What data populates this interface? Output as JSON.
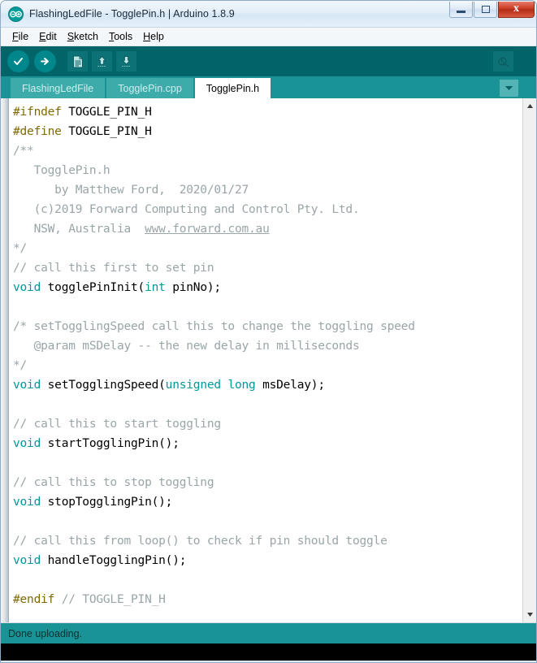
{
  "window": {
    "title": "FlashingLedFile - TogglePin.h | Arduino 1.8.9",
    "app_icon": "arduino-logo-icon",
    "controls": {
      "minimize_label": "Minimize",
      "maximize_label": "Maximize",
      "close_label": "x"
    }
  },
  "menu": {
    "items": [
      {
        "mnemonic": "F",
        "rest": "ile"
      },
      {
        "mnemonic": "E",
        "rest": "dit"
      },
      {
        "mnemonic": "S",
        "rest": "ketch"
      },
      {
        "mnemonic": "T",
        "rest": "ools"
      },
      {
        "mnemonic": "H",
        "rest": "elp"
      }
    ]
  },
  "toolbar": {
    "buttons": [
      {
        "name": "verify-button",
        "icon": "checkmark-icon",
        "tooltip": "Verify"
      },
      {
        "name": "upload-button",
        "icon": "right-arrow-icon",
        "tooltip": "Upload"
      },
      {
        "name": "new-button",
        "icon": "new-file-icon",
        "tooltip": "New"
      },
      {
        "name": "open-button",
        "icon": "up-arrow-icon",
        "tooltip": "Open"
      },
      {
        "name": "save-button",
        "icon": "down-arrow-icon",
        "tooltip": "Save"
      }
    ],
    "serial_monitor": {
      "icon": "serial-monitor-icon",
      "tooltip": "Serial Monitor"
    }
  },
  "tabs": {
    "items": [
      {
        "label": "FlashingLedFile",
        "active": false
      },
      {
        "label": "TogglePin.cpp",
        "active": false
      },
      {
        "label": "TogglePin.h",
        "active": true
      }
    ],
    "menu_icon": "chevron-down-icon"
  },
  "editor": {
    "file": "TogglePin.h",
    "lines": [
      [
        {
          "t": "#ifndef",
          "c": "k-pre"
        },
        {
          "t": " TOGGLE_PIN_H",
          "c": "k-id"
        }
      ],
      [
        {
          "t": "#define",
          "c": "k-pre"
        },
        {
          "t": " TOGGLE_PIN_H",
          "c": "k-id"
        }
      ],
      [
        {
          "t": "/**",
          "c": "k-com"
        }
      ],
      [
        {
          "t": "   TogglePin.h",
          "c": "k-com"
        }
      ],
      [
        {
          "t": "      by Matthew Ford,  2020/01/27",
          "c": "k-com"
        }
      ],
      [
        {
          "t": "   (c)2019 Forward Computing and Control Pty. Ltd.",
          "c": "k-com"
        }
      ],
      [
        {
          "t": "   NSW, Australia  ",
          "c": "k-com"
        },
        {
          "t": "www.forward.com.au",
          "c": "k-com-u"
        }
      ],
      [
        {
          "t": "*/",
          "c": "k-com"
        }
      ],
      [
        {
          "t": "// call this first to set pin",
          "c": "k-com"
        }
      ],
      [
        {
          "t": "void",
          "c": "k-type"
        },
        {
          "t": " togglePinInit(",
          "c": "k-id"
        },
        {
          "t": "int",
          "c": "k-type"
        },
        {
          "t": " pinNo);",
          "c": "k-id"
        }
      ],
      [
        {
          "t": "",
          "c": "k-id"
        }
      ],
      [
        {
          "t": "/* setTogglingSpeed call this to change the toggling speed",
          "c": "k-com"
        }
      ],
      [
        {
          "t": "   @param mSDelay -- the new delay in milliseconds",
          "c": "k-com"
        }
      ],
      [
        {
          "t": "*/",
          "c": "k-com"
        }
      ],
      [
        {
          "t": "void",
          "c": "k-type"
        },
        {
          "t": " setTogglingSpeed(",
          "c": "k-id"
        },
        {
          "t": "unsigned long",
          "c": "k-type"
        },
        {
          "t": " msDelay);",
          "c": "k-id"
        }
      ],
      [
        {
          "t": "",
          "c": "k-id"
        }
      ],
      [
        {
          "t": "// call this to start toggling",
          "c": "k-com"
        }
      ],
      [
        {
          "t": "void",
          "c": "k-type"
        },
        {
          "t": " startTogglingPin();",
          "c": "k-id"
        }
      ],
      [
        {
          "t": "",
          "c": "k-id"
        }
      ],
      [
        {
          "t": "// call this to stop toggling",
          "c": "k-com"
        }
      ],
      [
        {
          "t": "void",
          "c": "k-type"
        },
        {
          "t": " stopTogglingPin();",
          "c": "k-id"
        }
      ],
      [
        {
          "t": "",
          "c": "k-id"
        }
      ],
      [
        {
          "t": "// call this from loop() to check if pin should toggle",
          "c": "k-com"
        }
      ],
      [
        {
          "t": "void",
          "c": "k-type"
        },
        {
          "t": " handleTogglingPin();",
          "c": "k-id"
        }
      ],
      [
        {
          "t": "",
          "c": "k-id"
        }
      ],
      [
        {
          "t": "#endif",
          "c": "k-pre"
        },
        {
          "t": " ",
          "c": "k-id"
        },
        {
          "t": "// TOGGLE_PIN_H",
          "c": "k-com"
        }
      ]
    ],
    "scrollbar": {
      "up_icon": "scroll-up-arrow-icon",
      "down_icon": "scroll-down-arrow-icon"
    }
  },
  "status": {
    "message": "Done uploading."
  },
  "colors": {
    "toolbar_bg": "#006468",
    "tabbar_bg": "#1a9396",
    "status_bg": "#1a9396",
    "keyword_teal": "#00979c",
    "preprocessor": "#806a00",
    "comment_gray": "#9aa5a8",
    "close_button_red": "#cc3b25"
  }
}
